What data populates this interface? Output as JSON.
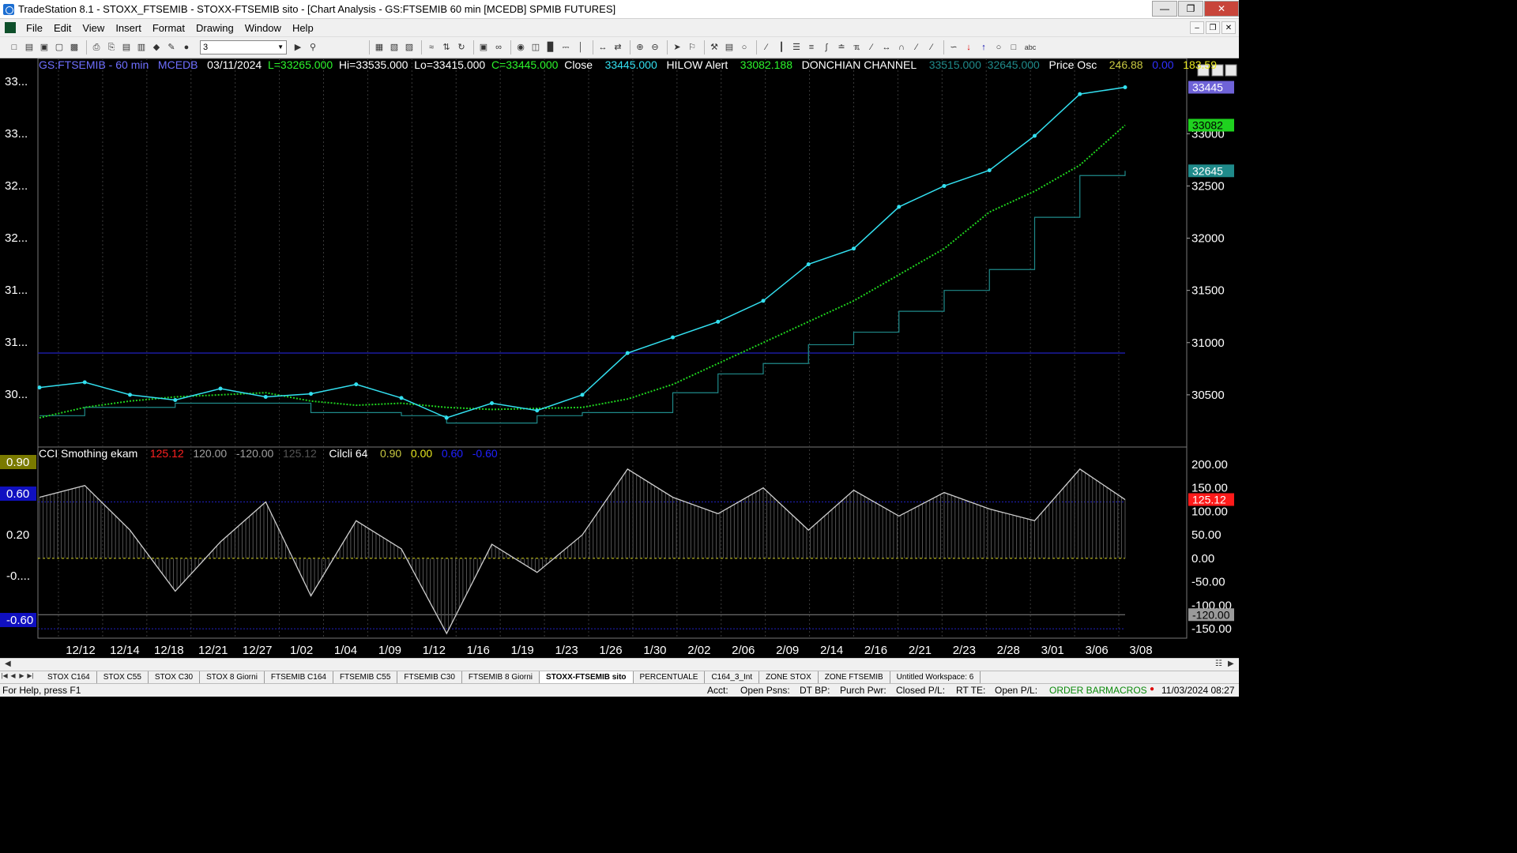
{
  "window": {
    "title": "TradeStation 8.1 - STOXX_FTSEMIB - STOXX-FTSEMIB sito - [Chart Analysis - GS:FTSEMIB  60 min  [MCEDB] SPMIB FUTURES]"
  },
  "menu": [
    "File",
    "Edit",
    "View",
    "Insert",
    "Format",
    "Drawing",
    "Window",
    "Help"
  ],
  "toolbar": {
    "interval_value": "3"
  },
  "price_header": {
    "symbol": "GS:FTSEMIB - 60 min",
    "datafeed": "MCEDB",
    "date": "03/11/2024",
    "low": "L=33265.000",
    "high": "Hi=33535.000",
    "lo": "Lo=33415.000",
    "close": "C=33445.000",
    "close_label": "Close",
    "close_value": "33445.000",
    "hilow_label": "HILOW Alert",
    "hilow_value": "33082.188",
    "donchian_label": "DONCHIAN CHANNEL",
    "donchian_upper": "33515.000",
    "donchian_lower": "32645.000",
    "osc_label": "Price Osc",
    "osc_v1": "246.88",
    "osc_v2": "0.00",
    "osc_v3": "183.59"
  },
  "cci_header": {
    "label": "CCI Smothing ekam",
    "v1": "125.12",
    "v2": "120.00",
    "v3": "-120.00",
    "v4": "125.12",
    "cycle_label": "Cilcli 64",
    "c1": "0.90",
    "c2": "0.00",
    "c3": "0.60",
    "c4": "-0.60"
  },
  "price_axis": {
    "right_ticks": [
      "33000",
      "32500",
      "32000",
      "31500",
      "31000",
      "30500"
    ],
    "left_ticks": [
      "33...",
      "33...",
      "32...",
      "32...",
      "31...",
      "31...",
      "30..."
    ],
    "tags": [
      {
        "text": "33445",
        "bg": "#6f63d8",
        "fg": "#ffffff"
      },
      {
        "text": "33082",
        "bg": "#1fd21f",
        "fg": "#000000"
      },
      {
        "text": "32645",
        "bg": "#1f8a8a",
        "fg": "#ffffff"
      }
    ]
  },
  "cci_axis": {
    "right_ticks": [
      "200.00",
      "150.00",
      "100.00",
      "50.00",
      "0.00",
      "-50.00",
      "-100.00",
      "-150.00"
    ],
    "left_ticks": [
      "0.90",
      "0.60",
      "0.20",
      "-0....",
      "-0.60"
    ],
    "tags": [
      {
        "text": "125.12",
        "bg": "#ff1a1a",
        "fg": "#ffffff"
      },
      {
        "text": "-120.00",
        "bg": "#9a9a9a",
        "fg": "#000000"
      }
    ]
  },
  "x_axis": [
    "12/12",
    "12/14",
    "12/18",
    "12/21",
    "12/27",
    "1/02",
    "1/04",
    "1/09",
    "1/12",
    "1/16",
    "1/19",
    "1/23",
    "1/26",
    "1/30",
    "2/02",
    "2/06",
    "2/09",
    "2/14",
    "2/16",
    "2/21",
    "2/23",
    "2/28",
    "3/01",
    "3/06",
    "3/08"
  ],
  "tabs": [
    "STOX C164",
    "STOX C55",
    "STOX  C30",
    "STOX  8 Giorni",
    "FTSEMIB C164",
    "FTSEMIB C55",
    "FTSEMIB C30",
    "FTSEMIB  8 Giorni",
    "STOXX-FTSEMIB sito",
    "PERCENTUALE",
    "C164_3_Int",
    "ZONE STOX",
    "ZONE FTSEMIB",
    "Untitled Workspace:  6"
  ],
  "active_tab": 8,
  "status": {
    "help": "For Help, press F1",
    "acct": "Acct:",
    "open_psns": "Open Psns:",
    "dt_bp": "DT BP:",
    "purch_pwr": "Purch Pwr:",
    "closed_pl": "Closed P/L:",
    "rt_te": "RT TE:",
    "open_pl": "Open P/L:",
    "order_bar": "ORDER BAR",
    "macros": "MACROS",
    "datetime": "11/03/2024 08:27"
  },
  "chart_data": {
    "type": "line",
    "symbol": "GS:FTSEMIB",
    "interval": "60 min",
    "ylim": [
      30000,
      33600
    ],
    "x": [
      "12/12",
      "12/14",
      "12/18",
      "12/21",
      "12/27",
      "1/02",
      "1/04",
      "1/09",
      "1/12",
      "1/16",
      "1/19",
      "1/23",
      "1/26",
      "1/30",
      "2/02",
      "2/06",
      "2/09",
      "2/14",
      "2/16",
      "2/21",
      "2/23",
      "2/28",
      "3/01",
      "3/06",
      "3/08"
    ],
    "series": [
      {
        "name": "Close",
        "color": "#33e0f0",
        "values": [
          30570,
          30620,
          30500,
          30450,
          30560,
          30480,
          30510,
          30600,
          30470,
          30280,
          30420,
          30350,
          30500,
          30900,
          31050,
          31200,
          31400,
          31750,
          31900,
          32300,
          32500,
          32650,
          32980,
          33380,
          33445
        ]
      },
      {
        "name": "HILOW Alert",
        "color": "#1fd21f",
        "values": [
          30280,
          30380,
          30440,
          30480,
          30500,
          30520,
          30440,
          30400,
          30420,
          30380,
          30360,
          30370,
          30380,
          30460,
          30600,
          30800,
          31000,
          31200,
          31400,
          31650,
          31900,
          32250,
          32450,
          32700,
          33082
        ]
      },
      {
        "name": "DONCHIAN CHANNEL",
        "color": "#1f8a8a",
        "values": [
          30300,
          30380,
          30380,
          30420,
          30420,
          30420,
          30330,
          30330,
          30300,
          30230,
          30230,
          30300,
          30330,
          30330,
          30520,
          30700,
          30800,
          30980,
          31100,
          31300,
          31500,
          31700,
          32200,
          32600,
          32645
        ]
      }
    ],
    "cci_ylim": [
      -170,
      210
    ],
    "cci": {
      "name": "CCI Smothing ekam",
      "values": [
        130,
        155,
        60,
        -70,
        35,
        120,
        -80,
        80,
        20,
        -160,
        30,
        -30,
        50,
        190,
        130,
        95,
        150,
        60,
        145,
        90,
        140,
        105,
        80,
        190,
        125
      ]
    }
  }
}
